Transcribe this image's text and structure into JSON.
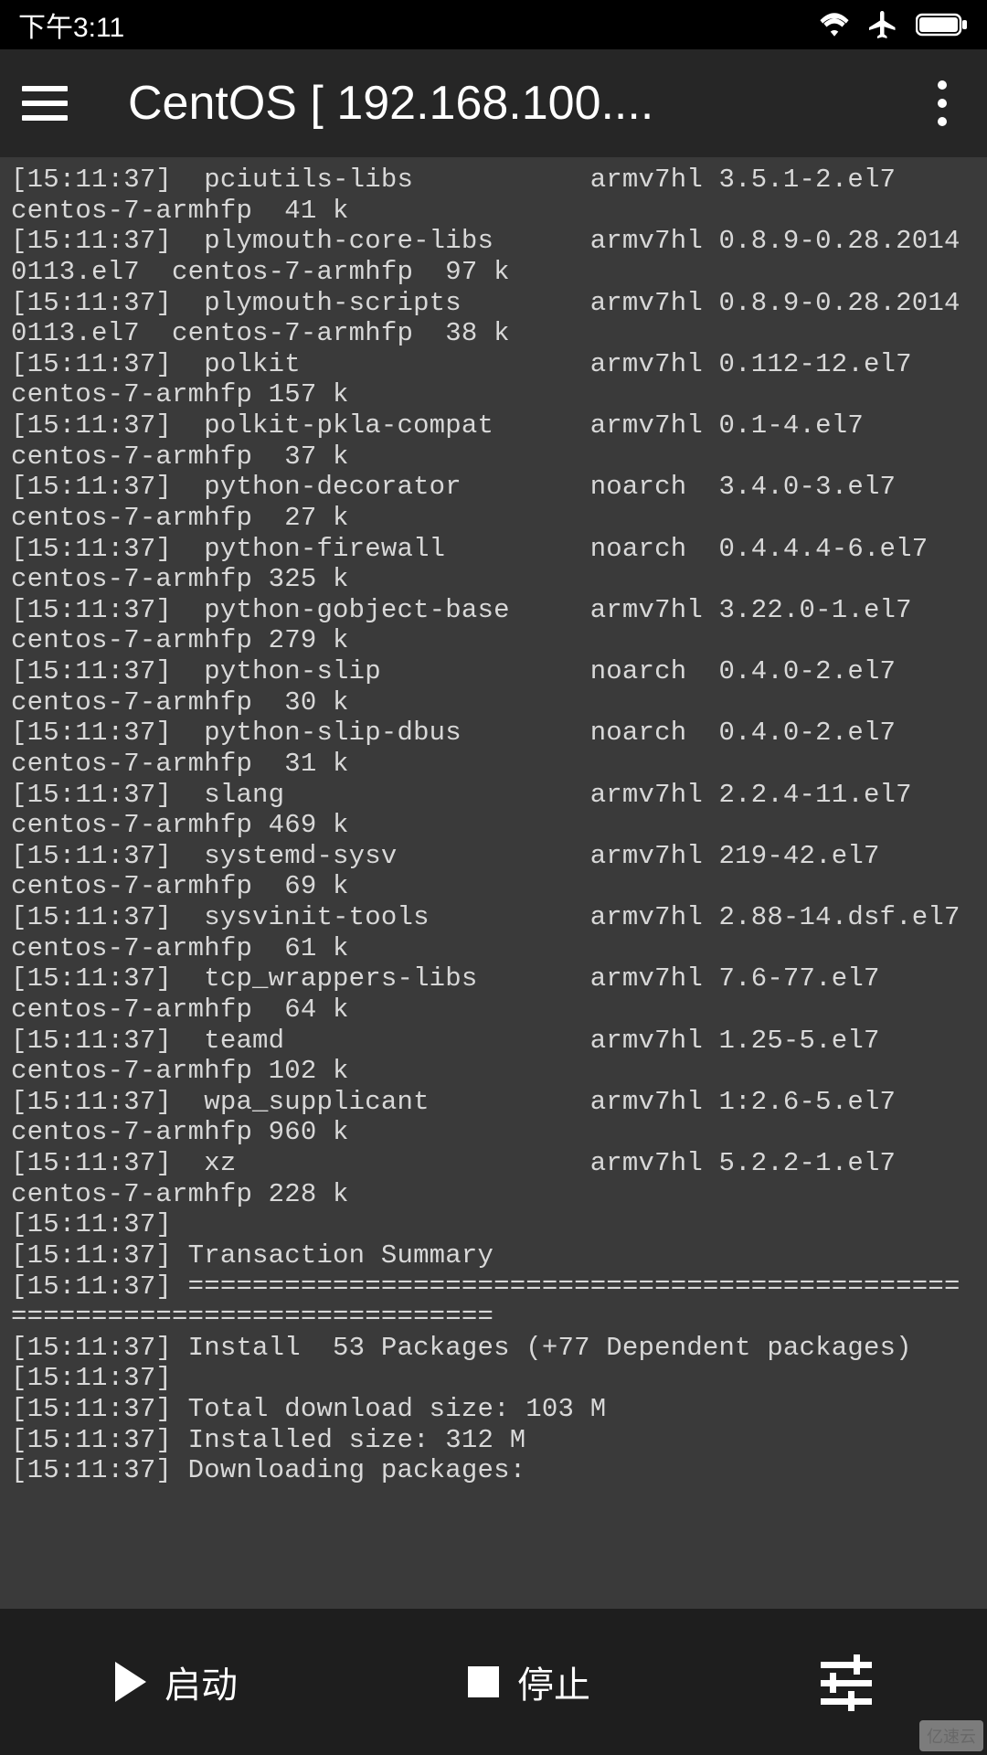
{
  "status": {
    "time": "下午3:11"
  },
  "appbar": {
    "title": "CentOS  [ 192.168.100...."
  },
  "terminal_lines": [
    "[15:11:37]  pciutils-libs           armv7hl 3.5.1-2.el7       centos-7-armhfp  41 k",
    "[15:11:37]  plymouth-core-libs      armv7hl 0.8.9-0.28.20140113.el7  centos-7-armhfp  97 k",
    "[15:11:37]  plymouth-scripts        armv7hl 0.8.9-0.28.20140113.el7  centos-7-armhfp  38 k",
    "[15:11:37]  polkit                  armv7hl 0.112-12.el7      centos-7-armhfp 157 k",
    "[15:11:37]  polkit-pkla-compat      armv7hl 0.1-4.el7         centos-7-armhfp  37 k",
    "[15:11:37]  python-decorator        noarch  3.4.0-3.el7       centos-7-armhfp  27 k",
    "[15:11:37]  python-firewall         noarch  0.4.4.4-6.el7     centos-7-armhfp 325 k",
    "[15:11:37]  python-gobject-base     armv7hl 3.22.0-1.el7      centos-7-armhfp 279 k",
    "[15:11:37]  python-slip             noarch  0.4.0-2.el7       centos-7-armhfp  30 k",
    "[15:11:37]  python-slip-dbus        noarch  0.4.0-2.el7       centos-7-armhfp  31 k",
    "[15:11:37]  slang                   armv7hl 2.2.4-11.el7      centos-7-armhfp 469 k",
    "[15:11:37]  systemd-sysv            armv7hl 219-42.el7        centos-7-armhfp  69 k",
    "[15:11:37]  sysvinit-tools          armv7hl 2.88-14.dsf.el7         centos-7-armhfp  61 k",
    "[15:11:37]  tcp_wrappers-libs       armv7hl 7.6-77.el7        centos-7-armhfp  64 k",
    "[15:11:37]  teamd                   armv7hl 1.25-5.el7        centos-7-armhfp 102 k",
    "[15:11:37]  wpa_supplicant          armv7hl 1:2.6-5.el7       centos-7-armhfp 960 k",
    "[15:11:37]  xz                      armv7hl 5.2.2-1.el7       centos-7-armhfp 228 k",
    "[15:11:37]",
    "[15:11:37] Transaction Summary",
    "[15:11:37] ==============================================================================",
    "[15:11:37] Install  53 Packages (+77 Dependent packages)",
    "[15:11:37]",
    "[15:11:37] Total download size: 103 M",
    "[15:11:37] Installed size: 312 M",
    "[15:11:37] Downloading packages:"
  ],
  "bottom": {
    "start": "启动",
    "stop": "停止"
  },
  "watermark": "亿速云"
}
